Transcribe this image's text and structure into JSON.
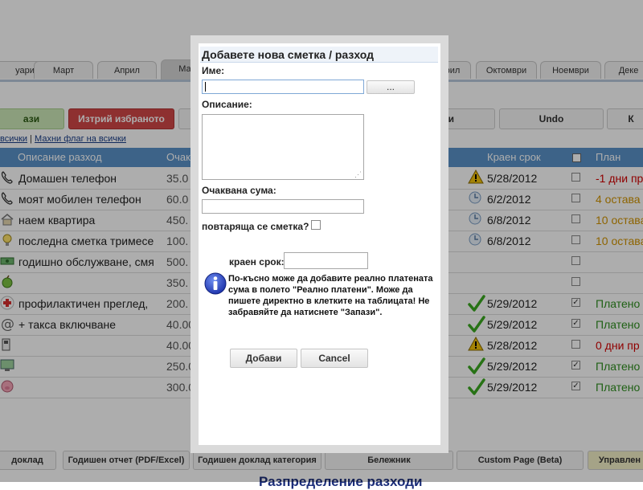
{
  "background": {
    "months": [
      "уари",
      "Март",
      "Април",
      "Ма",
      "рил",
      "Октомври",
      "Ноември",
      "Деке"
    ],
    "toolbar": {
      "save": "ази",
      "delete_selected": "Изтрий избраното",
      "other": "си",
      "undo": "Undo",
      "last": "К"
    },
    "flags": {
      "set_all": "всички",
      "separator": " | ",
      "clear_all": "Махни флаг на всички"
    },
    "table": {
      "headers": {
        "description": "Описание разход",
        "expected": "Очакв",
        "due": "Краен срок",
        "plan": "План"
      },
      "rows": [
        {
          "icon": "phone-icon",
          "desc": "Домашен телефон",
          "amount": "35.0",
          "status": "warning",
          "date": "5/28/2012",
          "checked": false,
          "plan": "-1 дни пр",
          "plan_color": "#d40000"
        },
        {
          "icon": "phone-icon",
          "desc": "моят мобилен телефон",
          "amount": "60.0",
          "status": "clock",
          "date": "6/2/2012",
          "checked": false,
          "plan": "4 остава",
          "plan_color": "#d19400"
        },
        {
          "icon": "house-icon",
          "desc": "наем квартира",
          "amount": "450.",
          "status": "clock",
          "date": "6/8/2012",
          "checked": false,
          "plan": "10 остава",
          "plan_color": "#d19400"
        },
        {
          "icon": "bulb-icon",
          "desc": "последна сметка тримесе",
          "amount": "100.",
          "status": "clock",
          "date": "6/8/2012",
          "checked": false,
          "plan": "10 остава",
          "plan_color": "#d19400"
        },
        {
          "icon": "money-icon",
          "desc": "годишно обслужване, смя",
          "amount": "500.",
          "status": "",
          "date": "",
          "checked": false,
          "plan": "",
          "plan_color": "#222"
        },
        {
          "icon": "apple-icon",
          "desc": "",
          "amount": "350.",
          "status": "",
          "date": "",
          "checked": false,
          "plan": "",
          "plan_color": "#222"
        },
        {
          "icon": "medical-icon",
          "desc": "профилактичен преглед,",
          "amount": "200.",
          "status": "check",
          "date": "5/29/2012",
          "checked": true,
          "plan": "Платено",
          "plan_color": "#2f8f1f"
        },
        {
          "icon": "at-icon",
          "desc": "+ такса включване",
          "amount": "40.00",
          "status": "check",
          "date": "5/29/2012",
          "checked": true,
          "plan": "Платено",
          "plan_color": "#2f8f1f"
        },
        {
          "icon": "fuel-icon",
          "desc": "",
          "amount": "40.00",
          "status": "warning",
          "date": "5/28/2012",
          "checked": false,
          "plan": "0 дни пр",
          "plan_color": "#d40000"
        },
        {
          "icon": "monitor-icon",
          "desc": "",
          "amount": "250.0",
          "status": "check",
          "date": "5/29/2012",
          "checked": true,
          "plan": "Платено",
          "plan_color": "#2f8f1f"
        },
        {
          "icon": "pig-icon",
          "desc": "",
          "amount": "300.0",
          "status": "check",
          "date": "5/29/2012",
          "checked": true,
          "plan": "Платено",
          "plan_color": "#2f8f1f"
        }
      ]
    },
    "bottom_buttons": [
      "доклад",
      "Годишен отчет (PDF/Excel)",
      "Годишен доклад категория",
      "Бележник",
      "Custom Page (Beta)",
      "Управлен"
    ],
    "bottom_heading": "Разпределение разходи"
  },
  "dialog": {
    "title": "Добавете нова сметка / разход",
    "name_label": "Име:",
    "name_value": "",
    "browse_label": "...",
    "description_label": "Описание:",
    "description_value": "",
    "amount_label": "Очаквана сума:",
    "amount_value": "",
    "recurring_label": "повтаряща се сметка?",
    "recurring_checked": false,
    "due_label": "краен срок:",
    "due_value": "",
    "info_text": "По-късно може да добавите реално платената сума в полето \"Реално платени\". Може да пишете директно в клетките на таблицата! Не забравяйте да натиснете \"Запази\".",
    "add_button": "Добави",
    "cancel_button": "Cancel"
  },
  "colors": {
    "header": "#5b93c9",
    "overlay": "rgba(0,0,0,0.32)",
    "danger": "#d24848",
    "success": "#2f8f1f",
    "warning": "#d19400"
  }
}
